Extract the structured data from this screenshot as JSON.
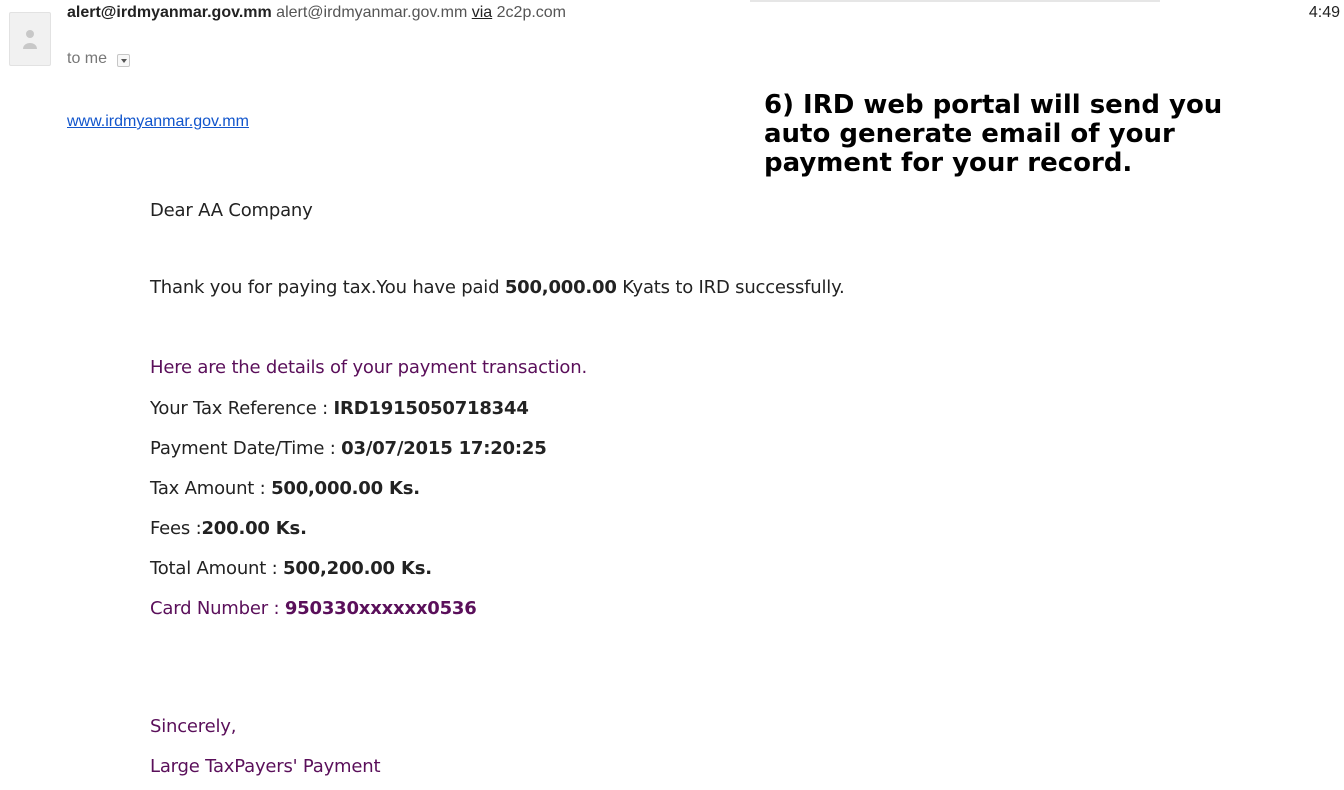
{
  "header": {
    "sender_name": "alert@irdmyanmar.gov.mm",
    "sender_email": "alert@irdmyanmar.gov.mm",
    "via_label": "via",
    "via_domain": "2c2p.com",
    "time": "4:49",
    "to_label": "to me"
  },
  "annotation": {
    "text": "6) IRD web portal will send you auto generate email of your payment for your record."
  },
  "email": {
    "website_link": "www.irdmyanmar.gov.mm",
    "greeting": "Dear AA Company",
    "thanks": {
      "prefix": "Thank you for paying tax.You have paid ",
      "amount": "500,000.00",
      "suffix": " Kyats to IRD successfully."
    },
    "details_intro": "Here are the details of your payment transaction.",
    "details": [
      {
        "label": "Your Tax Reference : ",
        "value": "IRD1915050718344"
      },
      {
        "label": "Payment Date/Time : ",
        "value": "03/07/2015 17:20:25"
      },
      {
        "label": "Tax Amount : ",
        "value": "500,000.00 Ks."
      },
      {
        "label": "Fees :",
        "value": "200.00 Ks."
      },
      {
        "label": "Total Amount : ",
        "value": "500,200.00 Ks."
      },
      {
        "label": "Card Number : ",
        "value": "950330xxxxxx0536"
      }
    ],
    "closing": "Sincerely,",
    "signature": "Large TaxPayers' Payment"
  },
  "colors": {
    "link": "#1155cc",
    "purple": "#5a0f5a",
    "text": "#222222"
  },
  "icons": {
    "avatar": "person-icon",
    "details_toggle": "dropdown-arrow-icon"
  }
}
